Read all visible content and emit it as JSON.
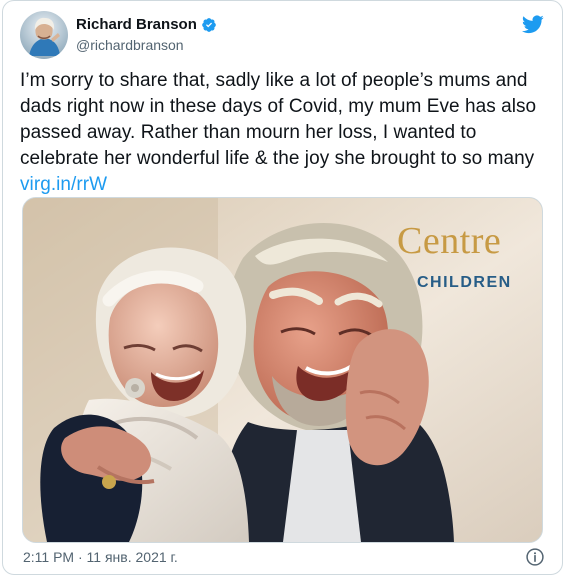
{
  "author": {
    "display_name": "Richard Branson",
    "handle": "@richardbranson",
    "verified": true,
    "verified_color": "#1d9bf0"
  },
  "brand": {
    "twitter_color": "#1d9bf0",
    "bird_icon": "twitter-bird-icon"
  },
  "tweet": {
    "text_before_link": "I’m sorry to share that, sadly like a lot of people’s mums and dads right now in these days of Covid, my mum Eve has also passed away. Rather than mourn her loss, I wanted to celebrate her wonderful life & the joy she brought to so many ",
    "link_text": "virg.in/rrW",
    "link_color": "#1d9bf0"
  },
  "photo": {
    "sign_title": "Centre",
    "sign_subtitle": "CHILDREN"
  },
  "footer": {
    "timestamp": "2:11 PM · 11 янв. 2021 г.",
    "info_icon": "info-icon"
  }
}
